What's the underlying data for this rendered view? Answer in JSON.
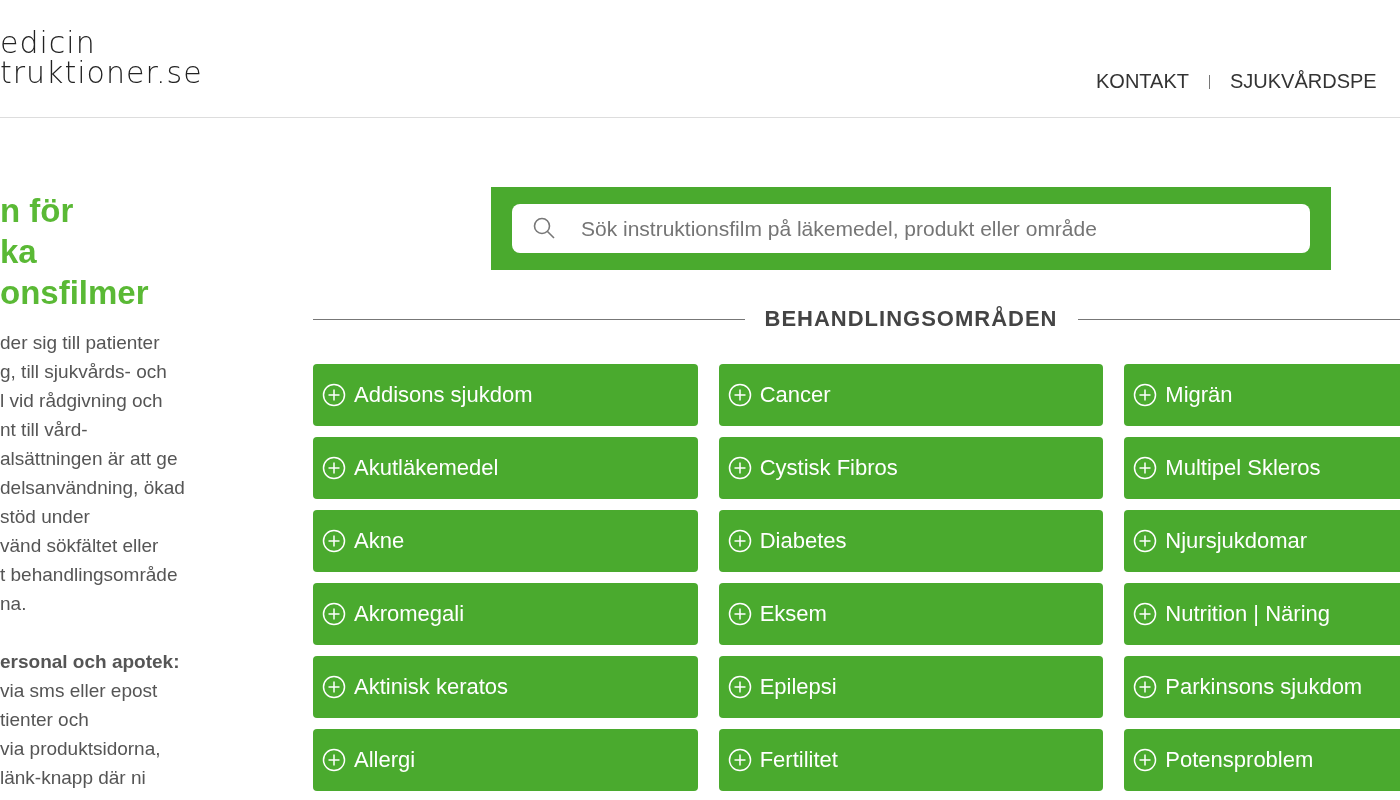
{
  "header": {
    "logo_lines": [
      "edicin",
      "truktioner.se"
    ],
    "nav": [
      {
        "label": "KONTAKT"
      },
      {
        "label": "SJUKVÅRDSPE"
      }
    ]
  },
  "intro": {
    "title_lines": [
      "n för",
      "ka",
      "onsfilmer"
    ],
    "paragraphs": [
      {
        "lines": [
          "der sig till patienter",
          "g, till sjukvårds- och",
          "l vid rådgivning och",
          "nt till vård-",
          "alsättningen är att ge",
          "delsanvändning, ökad",
          "stöd under",
          "vänd sökfältet eller",
          "t behandlingsområde",
          "na."
        ]
      },
      {
        "lines": [
          "**ersonal och apotek:**",
          "via sms eller epost",
          "tienter och",
          "via produktsidorna,",
          "länk-knapp där ni"
        ]
      }
    ]
  },
  "search": {
    "placeholder": "Sök instruktionsfilm på läkemedel, produkt eller område"
  },
  "section_title": "BEHANDLINGSOMRÅDEN",
  "areas": [
    "Addisons sjukdom",
    "Cancer",
    "Migrän",
    "Akutläkemedel",
    "Cystisk Fibros",
    "Multipel Skleros",
    "Akne",
    "Diabetes",
    "Njursjukdomar",
    "Akromegali",
    "Eksem",
    "Nutrition | Näring",
    "Aktinisk keratos",
    "Epilepsi",
    "Parkinsons sjukdom",
    "Allergi",
    "Fertilitet",
    "Potensproblem"
  ]
}
